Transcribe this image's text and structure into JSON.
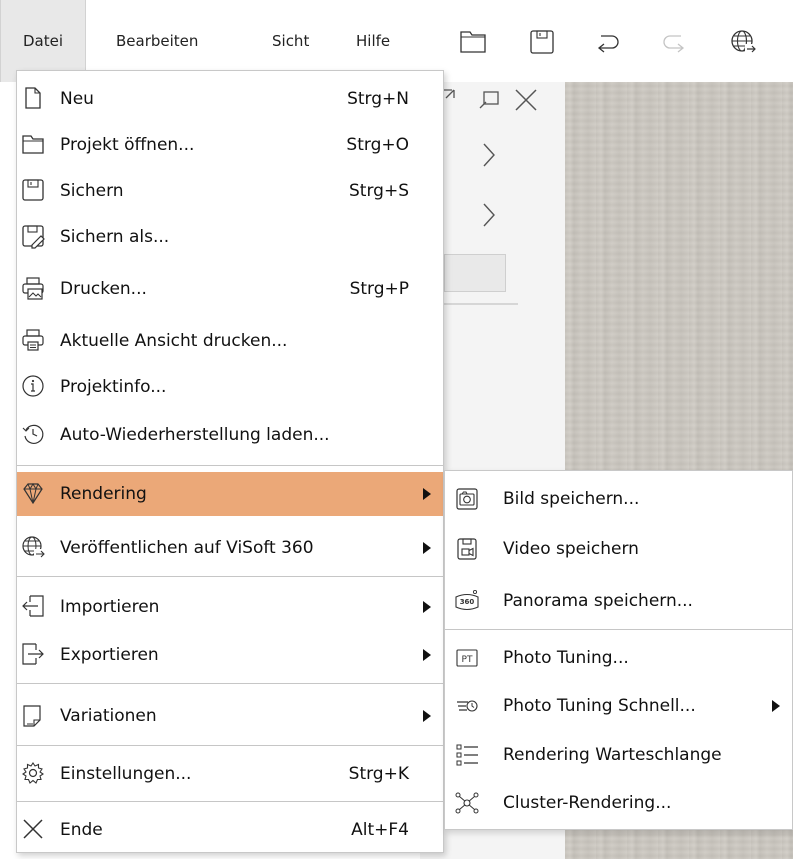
{
  "menubar": {
    "items": [
      "Datei",
      "Bearbeiten",
      "Sicht",
      "Hilfe"
    ],
    "active_index": 0,
    "toolbar_icons": [
      "open-folder-icon",
      "save-icon",
      "undo-icon",
      "redo-icon",
      "globe-share-icon"
    ]
  },
  "file_menu": {
    "items": [
      {
        "label": "Neu",
        "shortcut": "Strg+N",
        "icon": "new-document-icon"
      },
      {
        "label": "Projekt öffnen...",
        "shortcut": "Strg+O",
        "icon": "open-folder-icon"
      },
      {
        "label": "Sichern",
        "shortcut": "Strg+S",
        "icon": "save-icon"
      },
      {
        "label": "Sichern als...",
        "shortcut": "",
        "icon": "save-as-icon"
      },
      {
        "label": "Drucken...",
        "shortcut": "Strg+P",
        "icon": "print-image-icon"
      },
      {
        "label": "Aktuelle Ansicht drucken...",
        "shortcut": "",
        "icon": "printer-icon"
      },
      {
        "label": "Projektinfo...",
        "shortcut": "",
        "icon": "info-icon"
      },
      {
        "label": "Auto-Wiederherstellung laden...",
        "shortcut": "",
        "icon": "restore-icon"
      },
      {
        "label": "Rendering",
        "shortcut": "",
        "icon": "diamond-icon",
        "submenu": true,
        "highlighted": true
      },
      {
        "label": "Veröffentlichen auf ViSoft 360",
        "shortcut": "",
        "icon": "globe-share-icon",
        "submenu": true
      },
      {
        "label": "Importieren",
        "shortcut": "",
        "icon": "import-icon",
        "submenu": true
      },
      {
        "label": "Exportieren",
        "shortcut": "",
        "icon": "export-icon",
        "submenu": true
      },
      {
        "label": "Variationen",
        "shortcut": "",
        "icon": "variations-icon",
        "submenu": true
      },
      {
        "label": "Einstellungen...",
        "shortcut": "Strg+K",
        "icon": "gear-icon"
      },
      {
        "label": "Ende",
        "shortcut": "Alt+F4",
        "icon": "close-icon"
      }
    ]
  },
  "rendering_submenu": {
    "items": [
      {
        "label": "Bild speichern...",
        "icon": "camera-icon"
      },
      {
        "label": "Video speichern",
        "icon": "video-save-icon"
      },
      {
        "label": "Panorama speichern...",
        "icon": "panorama-360-icon",
        "badge": "360"
      },
      {
        "label": "Photo Tuning...",
        "icon": "photo-tuning-icon",
        "badge": "PT"
      },
      {
        "label": "Photo Tuning Schnell...",
        "icon": "quick-tuning-icon",
        "submenu": true
      },
      {
        "label": "Rendering Warteschlange",
        "icon": "queue-list-icon"
      },
      {
        "label": "Cluster-Rendering...",
        "icon": "cluster-icon"
      }
    ]
  },
  "colors": {
    "highlight": "#eba878",
    "menubar_active": "#e8e8e8"
  }
}
